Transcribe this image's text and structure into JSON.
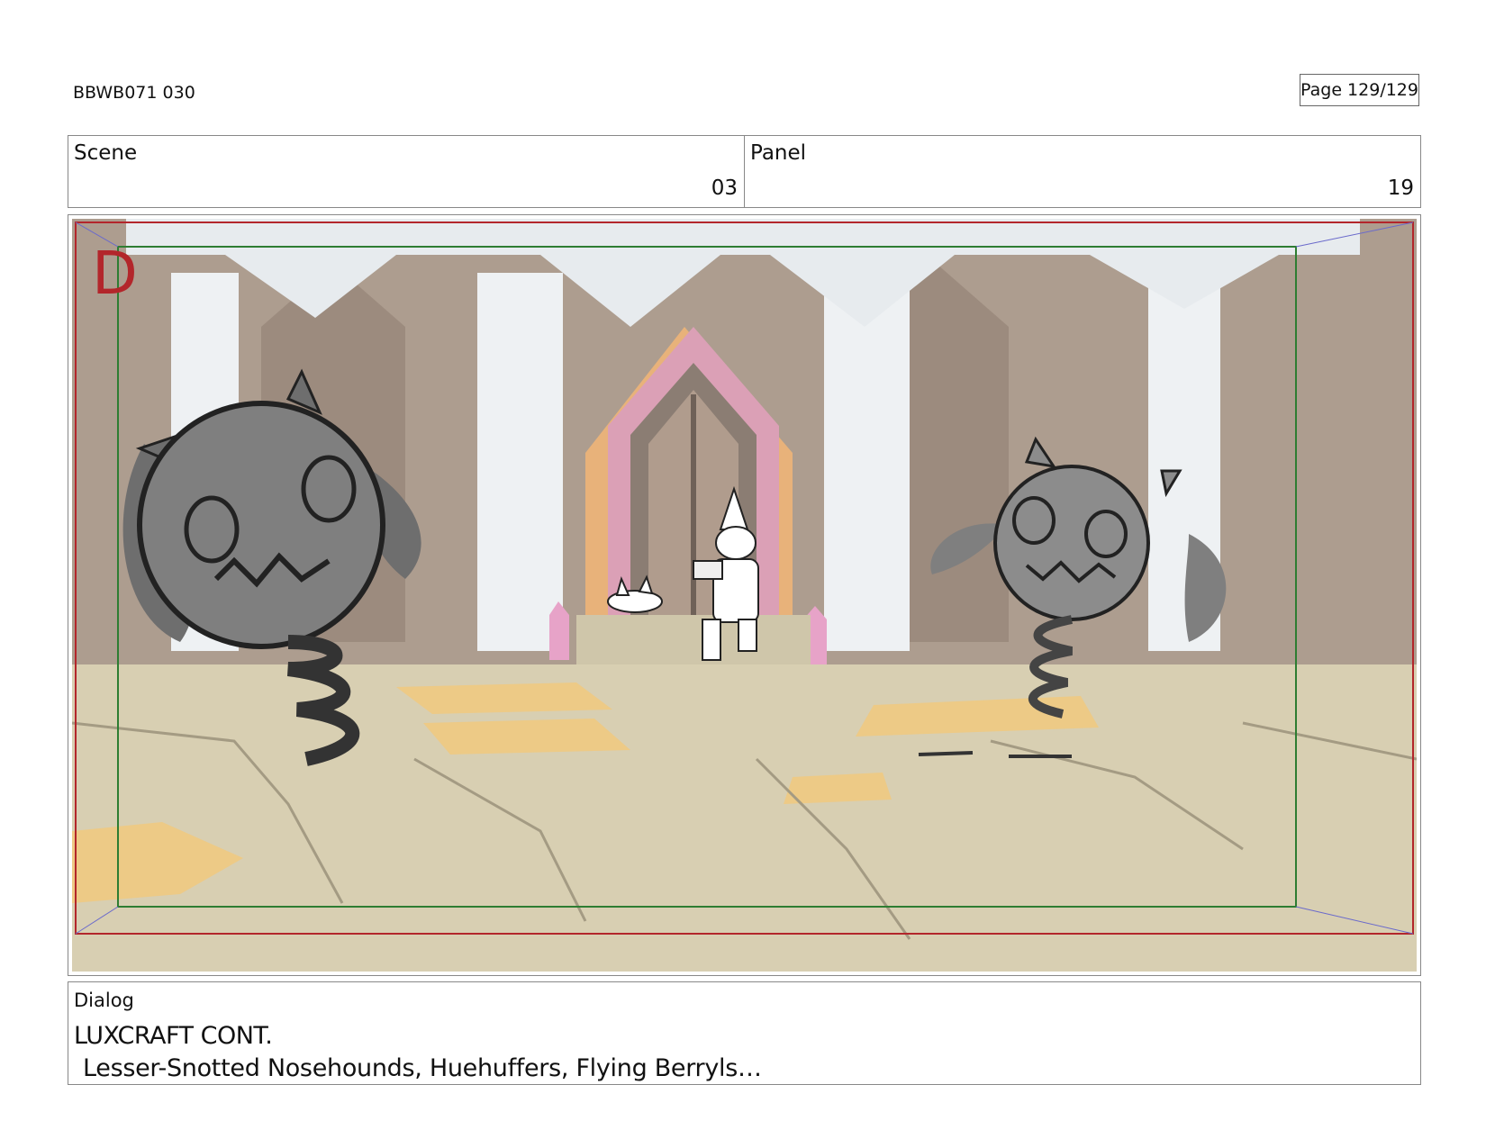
{
  "document": {
    "id": "BBWB071 030",
    "page": "Page 129/129"
  },
  "scene": {
    "label": "Scene",
    "value": "03"
  },
  "panel": {
    "label": "Panel",
    "value": "19",
    "mark": "D"
  },
  "dialog": {
    "label": "Dialog",
    "speaker": "LUXCRAFT CONT.",
    "line": "Lesser-Snotted Nosehounds, Huehuffers, Flying Berryls…"
  },
  "colors": {
    "frame_red": "#b3262b",
    "safe_green": "#2e7d32",
    "floor": "#d8cfb2",
    "wall": "#a8978a",
    "pillar": "#eef1f3",
    "door_pink": "#dba0b6",
    "door_orange": "#e8b27a",
    "floor_patch": "#f2c87a",
    "crystal": "#e7a3c8",
    "creature": "#7f7f7f"
  },
  "icons": [
    "storyboard-frame",
    "gnome-character-sketch",
    "creature-sketch"
  ]
}
